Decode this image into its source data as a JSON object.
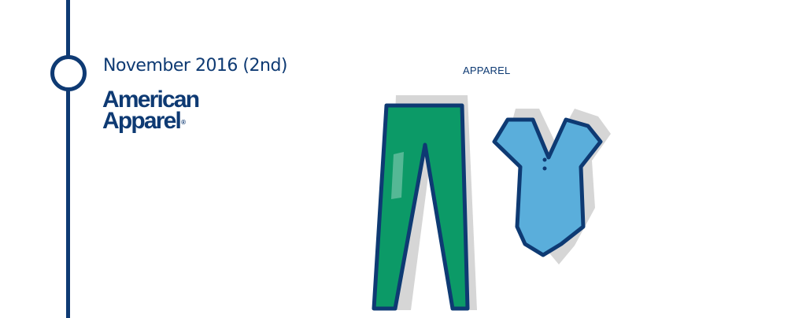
{
  "timeline": {
    "date": "November 2016 (2nd)"
  },
  "brand": {
    "line1": "American",
    "line2": "Apparel",
    "registered_mark": "®"
  },
  "category": {
    "label": "APPAREL"
  },
  "colors": {
    "navy": "#0e3a73",
    "pants_green": "#0c9a67",
    "bodysuit_blue": "#5aaedb",
    "shadow_gray": "#d6d6d6"
  },
  "icons": [
    "leggings-icon",
    "bodysuit-icon"
  ]
}
